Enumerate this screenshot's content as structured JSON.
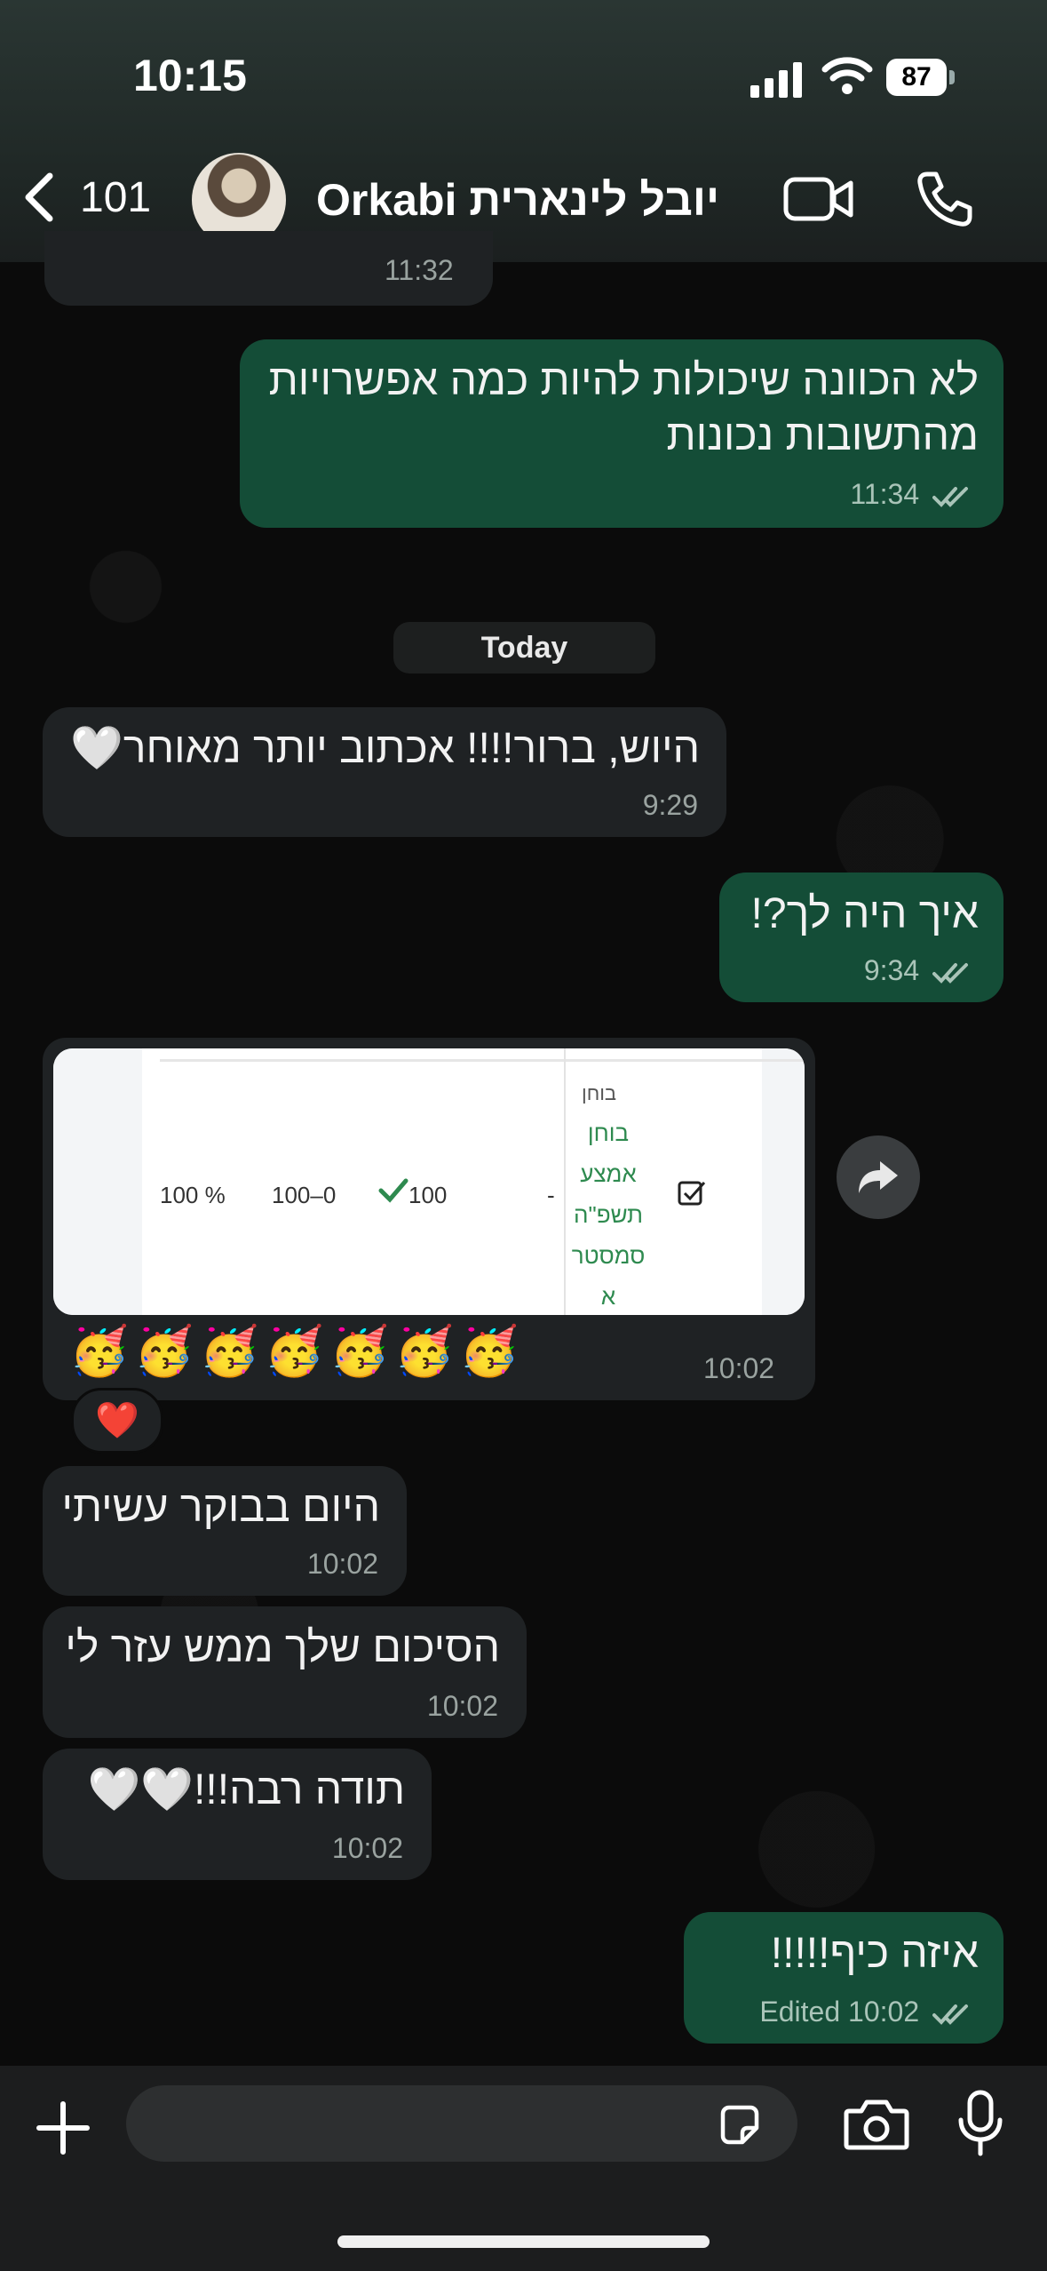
{
  "status_bar": {
    "time": "10:15",
    "battery": "87"
  },
  "header": {
    "back_count": "101",
    "chat_name": "Orkabi יובל לינארית"
  },
  "messages": [
    {
      "dir": "in",
      "text": "",
      "time": "11:32"
    },
    {
      "dir": "out",
      "lines": [
        "לא הכוונה שיכולות להיות כמה אפשרויות",
        "מהתשובות נכונות"
      ],
      "time": "11:34"
    },
    {
      "dir": "in",
      "text": "היוש, ברור!!!! אכתוב יותר מאוחר🤍",
      "time": "9:29"
    },
    {
      "dir": "out",
      "text": "איך  היה לך?!",
      "time": "9:34"
    },
    {
      "dir": "in",
      "emojis": "🥳🥳🥳🥳🥳🥳🥳",
      "time": "10:02",
      "reaction": "❤️"
    },
    {
      "dir": "in",
      "text": "היום בבוקר עשיתי",
      "time": "10:02"
    },
    {
      "dir": "in",
      "text": "הסיכום שלך ממש עזר לי",
      "time": "10:02"
    },
    {
      "dir": "in",
      "text": "תודה רבה!!!🤍🤍",
      "time": "10:02"
    },
    {
      "dir": "out",
      "text": "איזה כיף!!!!!",
      "time": "Edited 10:02"
    }
  ],
  "date_chip": "Today",
  "image_card": {
    "header": "בוחן",
    "exam_lines": [
      "בוחן",
      "אמצע",
      "תשפ\"ה",
      "סמסטר",
      "א"
    ],
    "cells": [
      "-",
      "100",
      "100–0",
      "100 %"
    ]
  },
  "composer": {
    "placeholder": ""
  },
  "colors": {
    "outgoing_bubble": "#144d37",
    "incoming_bubble": "#1f2224",
    "background": "#0b0b0b",
    "read_tick": "#a9c4b8"
  },
  "icons": [
    "back-chevron-icon",
    "video-call-icon",
    "phone-call-icon",
    "forward-icon",
    "plus-icon",
    "sticker-icon",
    "camera-icon",
    "microphone-icon",
    "signal-icon",
    "wifi-icon",
    "battery-icon",
    "checkbox-icon",
    "check-icon"
  ]
}
